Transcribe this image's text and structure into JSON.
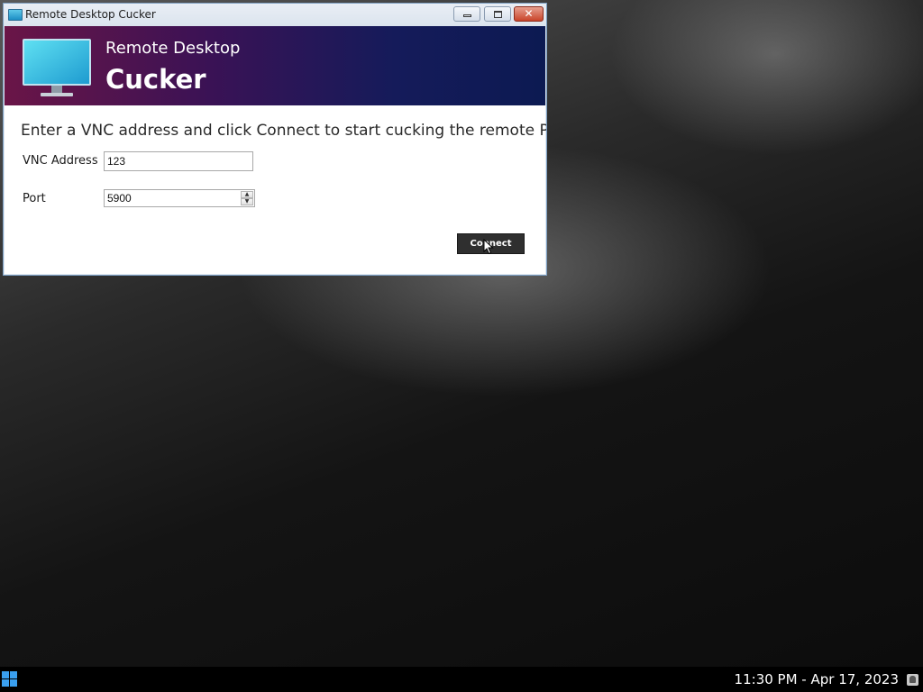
{
  "window": {
    "title": "Remote Desktop Cucker",
    "app_icon": "monitor-icon",
    "controls": {
      "minimize": "minimize-icon",
      "maximize": "maximize-icon",
      "close": "close-icon",
      "close_color": "#c9442a"
    }
  },
  "banner": {
    "line1": "Remote Desktop",
    "line2": "Cucker",
    "icon": "monitor-icon",
    "gradient_colors": [
      "#6a1547",
      "#3a1255",
      "#151b5a",
      "#0c1a52"
    ]
  },
  "form": {
    "instruction": "Enter a VNC address and click Connect to start cucking the remote PC.",
    "vnc_label": "VNC Address",
    "vnc_value": "123",
    "port_label": "Port",
    "port_value": "5900",
    "connect_label": "Connect"
  },
  "taskbar": {
    "start_icon": "windows-logo-icon",
    "clock": "11:30 PM - Apr 17, 2023",
    "tray_icon": "user-icon"
  }
}
